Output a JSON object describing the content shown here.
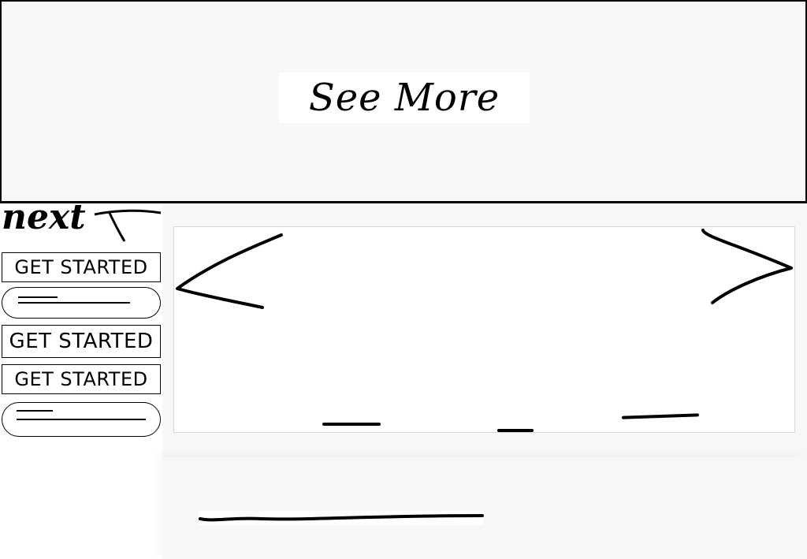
{
  "header": {
    "see_more_label": "See More"
  },
  "sidebar": {
    "next_label": "next",
    "buttons": [
      {
        "label": "GET STARTED"
      },
      {
        "label": "GET STARTED"
      },
      {
        "label": "GET STARTED"
      }
    ]
  },
  "carousel": {
    "prev_icon": "chevron-left-icon",
    "next_icon": "chevron-right-icon",
    "dot_count": 3
  },
  "colors": {
    "background": "#f7f7f7",
    "ink": "#000000",
    "panel": "#ffffff"
  }
}
